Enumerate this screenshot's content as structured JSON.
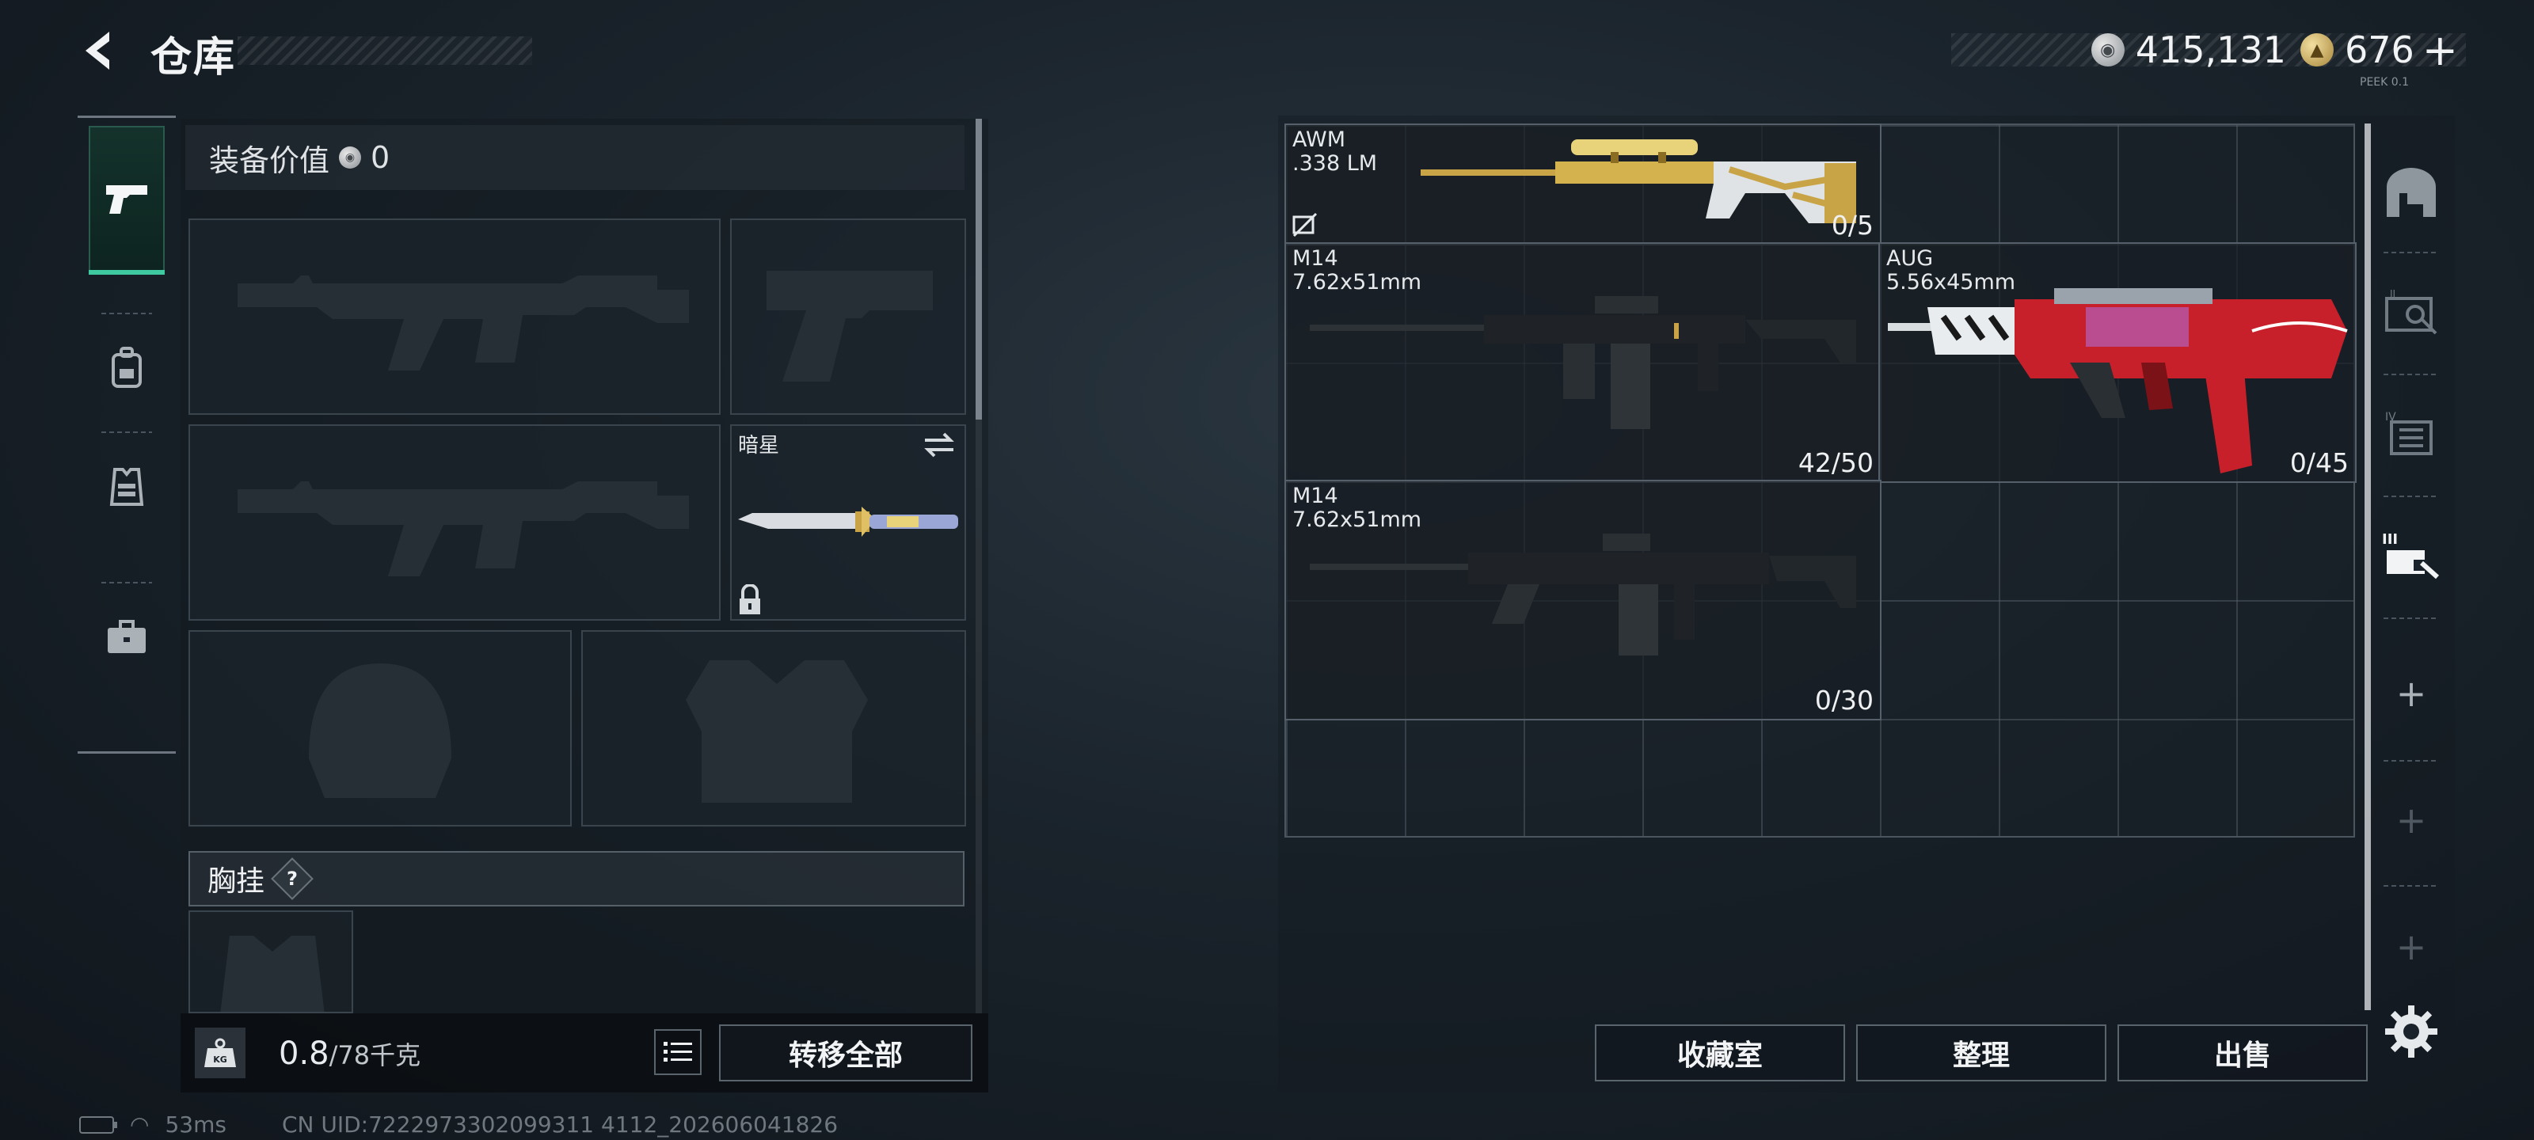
{
  "header": {
    "title": "仓库",
    "currency_silver": "415,131",
    "currency_gold": "676",
    "add_label": "+",
    "corner_tag": "PEEK 0.1"
  },
  "left_tabs": [
    {
      "name": "weapons",
      "icon": "pistol-icon",
      "active": true
    },
    {
      "name": "backpack",
      "icon": "backpack-icon",
      "active": false
    },
    {
      "name": "vest",
      "icon": "vest-icon",
      "active": false
    },
    {
      "name": "case",
      "icon": "briefcase-icon",
      "active": false
    }
  ],
  "equipment": {
    "value_label": "装备价值",
    "value": "0",
    "melee_name": "暗星",
    "chest_rig_label": "胸挂",
    "help_label": "?",
    "weight_unit_badge": "KG",
    "weight_current": "0.8",
    "weight_max": "/78千克",
    "transfer_all_label": "转移全部"
  },
  "stash_items": [
    {
      "name": "AWM",
      "ammo": ".338 LM",
      "count": "0/5"
    },
    {
      "name": "M14",
      "ammo": "7.62x51mm",
      "count": "42/50"
    },
    {
      "name": "AUG",
      "ammo": "5.56x45mm",
      "count": "0/45"
    },
    {
      "name": "M14",
      "ammo": "7.62x51mm",
      "count": "0/30"
    }
  ],
  "actions": {
    "collection_label": "收藏室",
    "sort_label": "整理",
    "sell_label": "出售"
  },
  "status_bar": {
    "ping": "53ms",
    "uid": "CN UID:7222973302099311 4112_202606041826"
  },
  "colors": {
    "accent_green": "#3ec9a1",
    "panel_border": "#56606a",
    "gold_skin": "#c9a446",
    "red_skin": "#c8202a"
  }
}
